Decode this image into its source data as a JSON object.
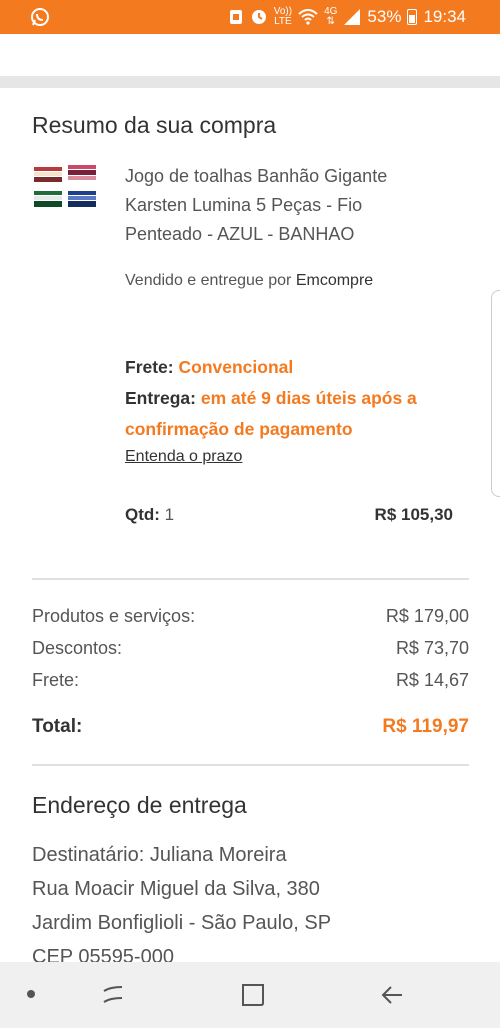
{
  "status_bar": {
    "network_label_top": "Vo))",
    "network_label_bottom": "LTE",
    "data_label": "4G",
    "battery": "53%",
    "time": "19:34",
    "bar_color": "#f47a20"
  },
  "summary": {
    "title": "Resumo da sua compra",
    "product_name": "Jogo de toalhas Banhão Gigante Karsten Lumina 5 Peças - Fio Penteado - AZUL - BANHAO",
    "seller_prefix": "Vendido e entregue por ",
    "seller_name": "Emcompre",
    "shipping_label": "Frete:",
    "shipping_value": "Convencional",
    "delivery_label": "Entrega:",
    "delivery_value": "em até 9 dias úteis após a confirmação de pagamento",
    "prazo_link": "Entenda o prazo",
    "qty_label": "Qtd:",
    "qty_value": "1",
    "item_price": "R$ 105,30"
  },
  "totals": {
    "products_label": "Produtos e serviços:",
    "products_value": "R$ 179,00",
    "discounts_label": "Descontos:",
    "discounts_value": "R$ 73,70",
    "shipping_label": "Frete:",
    "shipping_value": "R$ 14,67",
    "total_label": "Total:",
    "total_value": "R$ 119,97"
  },
  "address": {
    "title": "Endereço de entrega",
    "recipient": "Destinatário: Juliana Moreira",
    "street": "Rua Moacir Miguel da Silva, 380",
    "district": "Jardim Bonfiglioli - São Paulo, SP",
    "cep": "CEP 05595-000"
  },
  "colors": {
    "accent": "#f47a20",
    "text": "#333333",
    "muted": "#555555"
  },
  "icons": {
    "notification": "whatsapp-icon",
    "status": [
      "alarm-icon",
      "sync-icon",
      "wifi-icon",
      "signal-icon",
      "battery-icon"
    ],
    "nav": [
      "recent-apps-icon",
      "home-icon",
      "back-icon"
    ]
  }
}
